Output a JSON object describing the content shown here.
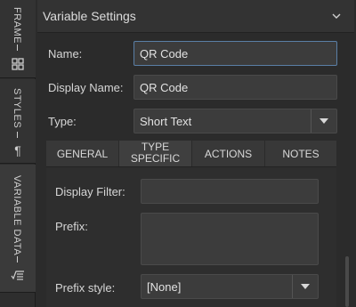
{
  "sidebar": {
    "tabs": [
      {
        "label": "FRAME",
        "icon": "grid-icon"
      },
      {
        "label": "STYLES",
        "icon": "pilcrow-icon"
      },
      {
        "label": "VARIABLE DATA",
        "icon": "variable-data-icon"
      }
    ],
    "pilcrow": "¶"
  },
  "panel": {
    "title": "Variable Settings",
    "fields": {
      "name_label": "Name:",
      "name_value": "QR Code",
      "display_name_label": "Display Name:",
      "display_name_value": "QR Code",
      "type_label": "Type:",
      "type_value": "Short Text"
    },
    "tabs": {
      "general": "GENERAL",
      "type_specific_line1": "TYPE",
      "type_specific_line2": "SPECIFIC",
      "actions": "ACTIONS",
      "notes": "NOTES"
    },
    "type_specific": {
      "display_filter_label": "Display Filter:",
      "display_filter_value": "",
      "prefix_label": "Prefix:",
      "prefix_value": "",
      "prefix_style_label": "Prefix style:",
      "prefix_style_value": "[None]"
    }
  }
}
